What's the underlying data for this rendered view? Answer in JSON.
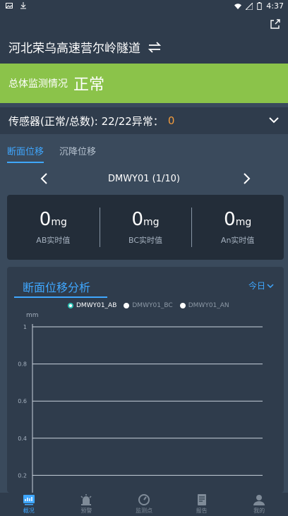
{
  "statusbar": {
    "time": "4:37"
  },
  "header": {
    "title": "河北荣乌高速营尔岭隧道"
  },
  "overall": {
    "label": "总体监测情况",
    "value": "正常"
  },
  "sensors": {
    "label": "传感器(正常/总数): 22/22异常：",
    "abnormal": "0"
  },
  "tabs": [
    "断面位移",
    "沉降位移"
  ],
  "pager": {
    "label": "DMWY01 (1/10)"
  },
  "cards": [
    {
      "value": "0",
      "unit": "mg",
      "caption": "AB实时值"
    },
    {
      "value": "0",
      "unit": "mg",
      "caption": "BC实时值"
    },
    {
      "value": "0",
      "unit": "mg",
      "caption": "An实时值"
    }
  ],
  "panel": {
    "title": "断面位移分析",
    "range": "今日"
  },
  "chart_data": {
    "type": "line",
    "ylabel": "mm",
    "ylim": [
      0,
      1
    ],
    "yticks": [
      "1",
      "0.8",
      "0.6",
      "0.4",
      "0.2"
    ],
    "series": [
      {
        "name": "DMWY01_AB",
        "color": "#2ec4b6",
        "active": true
      },
      {
        "name": "DMWY01_BC",
        "color": "#9aa7b4",
        "active": false
      },
      {
        "name": "DMWY01_AN",
        "color": "#9aa7b4",
        "active": false
      }
    ]
  },
  "nav": [
    {
      "label": "概况",
      "icon": "chart-icon",
      "active": true
    },
    {
      "label": "预警",
      "icon": "alarm-icon",
      "active": false
    },
    {
      "label": "监测点",
      "icon": "gauge-icon",
      "active": false
    },
    {
      "label": "报告",
      "icon": "report-icon",
      "active": false
    },
    {
      "label": "我的",
      "icon": "user-icon",
      "active": false
    }
  ]
}
